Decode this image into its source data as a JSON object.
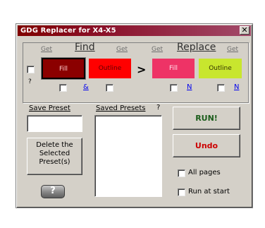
{
  "window": {
    "title": "GDG Replacer for X4-X5",
    "close_glyph": "✕"
  },
  "find": {
    "heading": "Find",
    "get_left": "Get",
    "get_right": "Get",
    "fill_label": "Fill",
    "outline_label": "Outline",
    "fill_color": "#8b0000",
    "outline_color": "#ff0000",
    "and_link": "&",
    "question": "?"
  },
  "arrow": ">",
  "replace": {
    "heading": "Replace",
    "get_left": "Get",
    "get_right": "Get",
    "fill_label": "Fill",
    "outline_label": "Outline",
    "fill_color": "#ee3366",
    "outline_color": "#c8e62e",
    "fill_n": "N",
    "outline_n": "N"
  },
  "presets": {
    "save_label": "Save Preset",
    "save_value": "",
    "saved_label": "Saved Presets",
    "help_mark": "?",
    "delete_button": "Delete the Selected Preset(s)",
    "help_glyph": "?"
  },
  "actions": {
    "run": "RUN!",
    "undo": "Undo",
    "all_pages": "All pages",
    "run_at_start": "Run at start"
  }
}
